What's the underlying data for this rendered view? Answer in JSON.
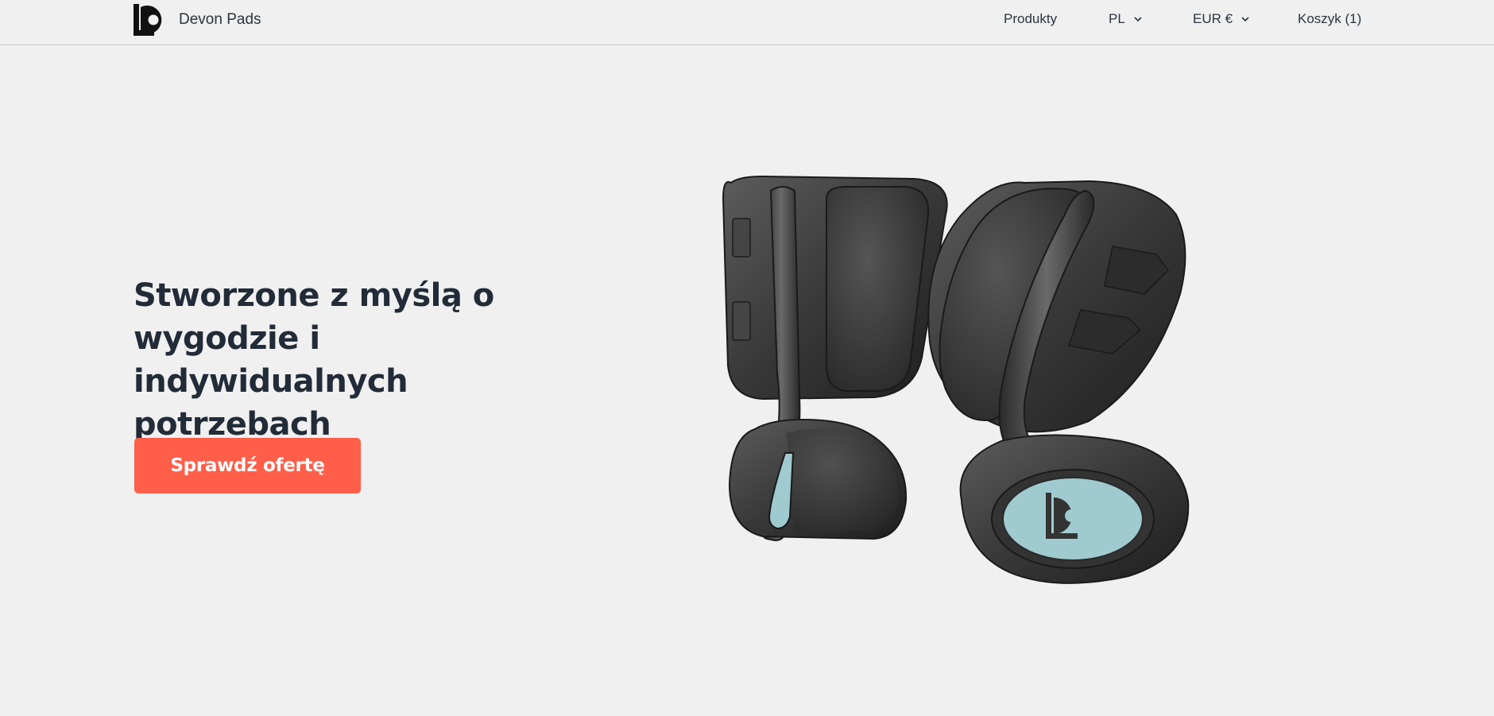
{
  "header": {
    "brand_name": "Devon Pads",
    "nav": {
      "products": "Produkty",
      "language": "PL",
      "currency": "EUR €",
      "cart": "Koszyk (1)"
    }
  },
  "hero": {
    "title_line1": "Stworzone z myślą o",
    "title_line2": "wygodzie i indywidualnych",
    "title_line3": "potrzebach",
    "cta_label": "Sprawdź ofertę"
  },
  "colors": {
    "background": "#f0f0f0",
    "text": "#222b38",
    "accent": "#ff5e49",
    "product_dark": "#3a3a3a",
    "product_accent": "#9fcbd0"
  },
  "icons": {
    "logo": "devon-logo-icon",
    "dropdown": "chevron-down-icon"
  }
}
